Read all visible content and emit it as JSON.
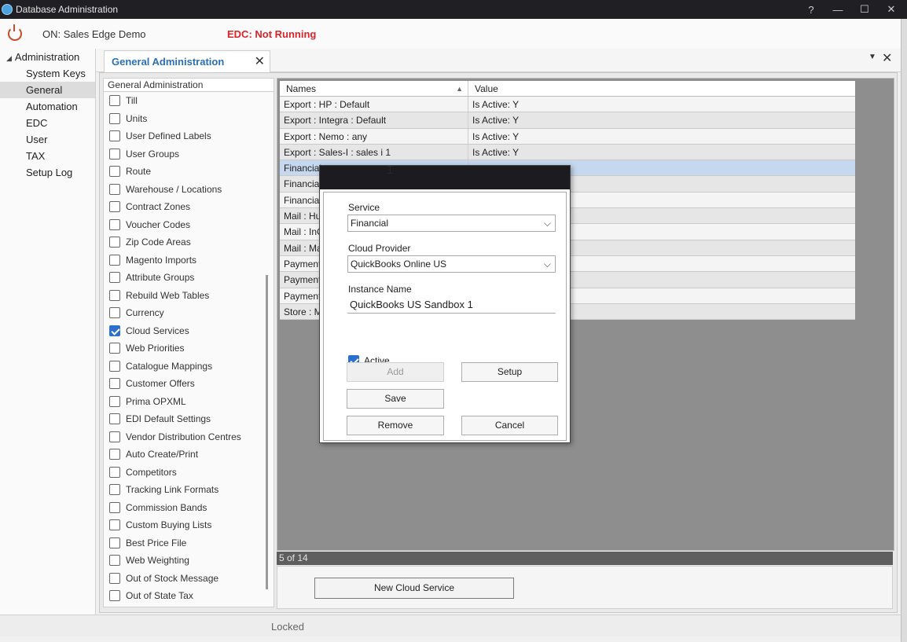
{
  "window": {
    "title": "Database Administration",
    "controls": {
      "help": "?",
      "minimize": "—",
      "maximize": "☐",
      "close": "✕"
    }
  },
  "status": {
    "connection": "ON: Sales Edge Demo",
    "edc": "EDC: Not Running",
    "edc_color": "#d8242a"
  },
  "tree": {
    "root": "Administration",
    "items": [
      "System Keys",
      "General",
      "Automation",
      "EDC",
      "User",
      "TAX",
      "Setup Log"
    ],
    "selected": "General"
  },
  "tab": {
    "label": "General Administration",
    "close": "✕",
    "dropdown": "▼",
    "panel_close": "✕"
  },
  "checklist": {
    "header": "General Administration",
    "items": [
      {
        "label": "Till",
        "checked": false
      },
      {
        "label": "Units",
        "checked": false
      },
      {
        "label": "User Defined Labels",
        "checked": false
      },
      {
        "label": "User Groups",
        "checked": false
      },
      {
        "label": "Route",
        "checked": false
      },
      {
        "label": "Warehouse / Locations",
        "checked": false
      },
      {
        "label": "Contract Zones",
        "checked": false
      },
      {
        "label": "Voucher Codes",
        "checked": false
      },
      {
        "label": "Zip Code Areas",
        "checked": false
      },
      {
        "label": "Magento Imports",
        "checked": false
      },
      {
        "label": "Attribute Groups",
        "checked": false
      },
      {
        "label": "Rebuild Web Tables",
        "checked": false
      },
      {
        "label": "Currency",
        "checked": false
      },
      {
        "label": "Cloud Services",
        "checked": true
      },
      {
        "label": "Web Priorities",
        "checked": false
      },
      {
        "label": "Catalogue Mappings",
        "checked": false
      },
      {
        "label": "Customer Offers",
        "checked": false
      },
      {
        "label": "Prima OPXML",
        "checked": false
      },
      {
        "label": "EDI Default Settings",
        "checked": false
      },
      {
        "label": "Vendor Distribution Centres",
        "checked": false
      },
      {
        "label": "Auto Create/Print",
        "checked": false
      },
      {
        "label": "Competitors",
        "checked": false
      },
      {
        "label": "Tracking Link Formats",
        "checked": false
      },
      {
        "label": "Commission Bands",
        "checked": false
      },
      {
        "label": "Custom Buying Lists",
        "checked": false
      },
      {
        "label": "Best Price File",
        "checked": false
      },
      {
        "label": "Web Weighting",
        "checked": false
      },
      {
        "label": "Out of Stock Message",
        "checked": false
      },
      {
        "label": "Out of State Tax",
        "checked": false
      }
    ]
  },
  "grid": {
    "columns": [
      "Names",
      "Value"
    ],
    "rows": [
      {
        "name": "Export : HP : Default",
        "value": "Is Active: Y"
      },
      {
        "name": "Export : Integra : Default",
        "value": "Is Active: Y"
      },
      {
        "name": "Export : Nemo : any",
        "value": "Is Active: Y"
      },
      {
        "name": "Export : Sales-I : sales i 1",
        "value": "Is Active: Y"
      },
      {
        "name": "Financial",
        "value": ""
      },
      {
        "name": "Financial",
        "value": ""
      },
      {
        "name": "Financial",
        "value": ""
      },
      {
        "name": "Mail : Hu",
        "value": ""
      },
      {
        "name": "Mail : InC",
        "value": ""
      },
      {
        "name": "Mail : Ma",
        "value": ""
      },
      {
        "name": "Payment",
        "value": ""
      },
      {
        "name": "Payment",
        "value": ""
      },
      {
        "name": "Payment",
        "value": ""
      },
      {
        "name": "Store : M",
        "value": ""
      }
    ],
    "selected_index": 4,
    "footer": "5 of 14"
  },
  "new_cloud_button": "New Cloud Service",
  "bottom_status": "Locked",
  "dialog": {
    "service_label": "Service",
    "service_value": "Financial",
    "provider_label": "Cloud Provider",
    "provider_value": "QuickBooks Online US",
    "instance_label": "Instance Name",
    "instance_value": "QuickBooks US Sandbox 1",
    "active_label": "Active",
    "active_checked": true,
    "buttons": {
      "add": "Add",
      "setup": "Setup",
      "save": "Save",
      "remove": "Remove",
      "cancel": "Cancel"
    }
  }
}
